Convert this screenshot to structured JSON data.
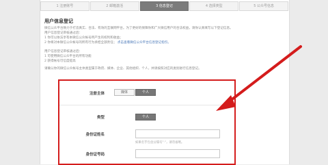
{
  "steps": [
    {
      "label": "1 注册账号",
      "active": false
    },
    {
      "label": "2 邮箱激活",
      "active": false
    },
    {
      "label": "3 信息登记",
      "active": true
    },
    {
      "label": "4 选择类型",
      "active": false
    },
    {
      "label": "5 公众号信息",
      "active": false
    }
  ],
  "info": {
    "title": "用户信息登记",
    "paragraph1_line1": "微信公众平台致力于打造真实、合法、有效的互联网平台。为了更好的保障你和广大微信用户的合法权益，请你认真填写以下登记信息。",
    "paragraph1_line2": "用户信息登记审核通过后：",
    "paragraph1_line3": "1 你可以依法享有本微信公众帐号所产生的权利和收益；",
    "paragraph1_line4": "2 你将对本微信公众帐号的所有行为承担全部责任；",
    "link_text": "点击查看微信公众平台信息登记指引。",
    "list_title": "用户信息登记审核通过后：",
    "list_item1": "1 可使用微信公众平台的所有功能",
    "list_item2": "2 获得帐号可信度提高",
    "note": "请确认你的微信公众帐号主体类型属于政府、媒体、企业、其他组织、个人，并请按照对应的类别进行信息登记。"
  },
  "form": {
    "subject_label": "注册主体",
    "subject_options": [
      "媒体",
      "个人"
    ],
    "subject_selected": "个人",
    "type_label": "类型",
    "type_value": "个人",
    "id_name_label": "身份证姓名",
    "id_name_value": "",
    "id_name_hint": "如果名字包含分隔号\"·\"，请勿省略。",
    "id_number_label": "身份证号码",
    "id_number_value": ""
  },
  "colors": {
    "highlight": "#d41c1c",
    "active_step": "#7b7b7b"
  }
}
